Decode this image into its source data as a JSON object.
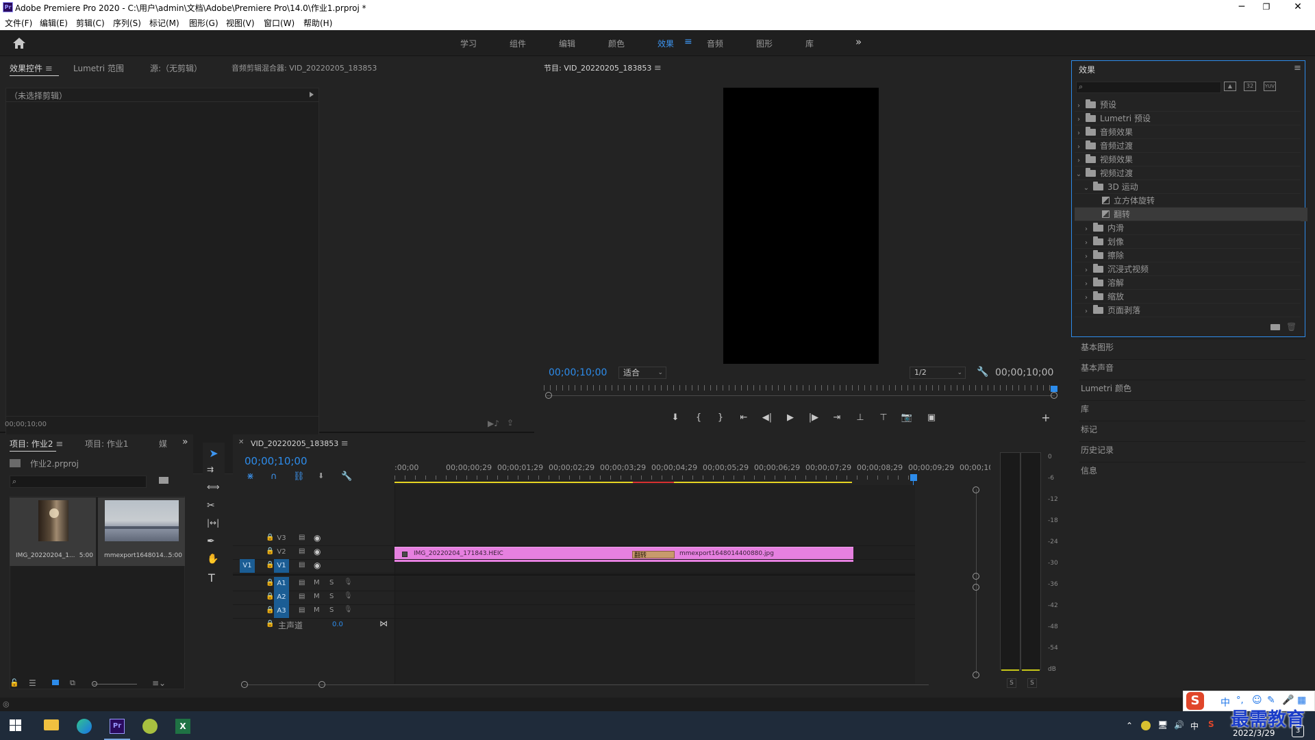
{
  "window": {
    "title": "Adobe Premiere Pro 2020 - C:\\用户\\admin\\文档\\Adobe\\Premiere Pro\\14.0\\作业1.prproj *",
    "menus": [
      "文件(F)",
      "编辑(E)",
      "剪辑(C)",
      "序列(S)",
      "标记(M)",
      "图形(G)",
      "视图(V)",
      "窗口(W)",
      "帮助(H)"
    ]
  },
  "workspaces": [
    "学习",
    "组件",
    "编辑",
    "颜色",
    "效果",
    "音频",
    "图形",
    "库"
  ],
  "effect_controls": {
    "tabs": [
      "效果控件",
      "Lumetri 范围",
      "源:（无剪辑）",
      "音频剪辑混合器: VID_20220205_183853"
    ],
    "no_clip": "（未选择剪辑）",
    "timecode": "00;00;10;00"
  },
  "program_monitor": {
    "title": "节目: VID_20220205_183853",
    "timecode_left": "00;00;10;00",
    "fit": "适合",
    "resolution": "1/2",
    "timecode_right": "00;00;10;00"
  },
  "effects_panel": {
    "title": "效果",
    "search_placeholder": "",
    "tree": [
      {
        "label": "预设",
        "level": 0,
        "expanded": false,
        "kind": "preset"
      },
      {
        "label": "Lumetri 预设",
        "level": 0,
        "expanded": false,
        "kind": "preset"
      },
      {
        "label": "音频效果",
        "level": 0,
        "expanded": false,
        "kind": "folder"
      },
      {
        "label": "音频过渡",
        "level": 0,
        "expanded": false,
        "kind": "folder"
      },
      {
        "label": "视频效果",
        "level": 0,
        "expanded": false,
        "kind": "folder"
      },
      {
        "label": "视频过渡",
        "level": 0,
        "expanded": true,
        "kind": "folder"
      },
      {
        "label": "3D 运动",
        "level": 1,
        "expanded": true,
        "kind": "folder"
      },
      {
        "label": "立方体旋转",
        "level": 2,
        "expanded": false,
        "kind": "effect"
      },
      {
        "label": "翻转",
        "level": 2,
        "expanded": false,
        "kind": "effect",
        "selected": true
      },
      {
        "label": "内滑",
        "level": 1,
        "expanded": false,
        "kind": "folder"
      },
      {
        "label": "划像",
        "level": 1,
        "expanded": false,
        "kind": "folder"
      },
      {
        "label": "擦除",
        "level": 1,
        "expanded": false,
        "kind": "folder"
      },
      {
        "label": "沉浸式视频",
        "level": 1,
        "expanded": false,
        "kind": "folder"
      },
      {
        "label": "溶解",
        "level": 1,
        "expanded": false,
        "kind": "folder"
      },
      {
        "label": "缩放",
        "level": 1,
        "expanded": false,
        "kind": "folder"
      },
      {
        "label": "页面剥落",
        "level": 1,
        "expanded": false,
        "kind": "folder"
      }
    ]
  },
  "right_panels": [
    "基本图形",
    "基本声音",
    "Lumetri 颜色",
    "库",
    "标记",
    "历史记录",
    "信息"
  ],
  "project_panel": {
    "tabs": [
      "项目: 作业2",
      "项目: 作业1",
      "媒"
    ],
    "file": "作业2.prproj",
    "items": [
      {
        "name": "IMG_20220204_1...",
        "duration": "5:00"
      },
      {
        "name": "mmexport1648014...",
        "duration": "5:00"
      }
    ]
  },
  "timeline": {
    "tab": "VID_20220205_183853",
    "timecode": "00;00;10;00",
    "ruler": [
      ":00;00",
      "00;00;00;29",
      "00;00;01;29",
      "00;00;02;29",
      "00;00;03;29",
      "00;00;04;29",
      "00;00;05;29",
      "00;00;06;29",
      "00;00;07;29",
      "00;00;08;29",
      "00;00;09;29",
      "00;00;10;"
    ],
    "video_tracks": [
      "V3",
      "V2",
      "V1"
    ],
    "audio_tracks": [
      "A1",
      "A2",
      "A3"
    ],
    "source_patch": "V1",
    "master_label": "主声道",
    "master_value": "0.0",
    "clip1": "IMG_20220204_171843.HEIC",
    "clip2": "mmexport1648014400880.jpg",
    "transition": "翻转",
    "ms": [
      "M",
      "S"
    ]
  },
  "meter": {
    "scale": [
      "0",
      "-6",
      "-12",
      "-18",
      "-24",
      "-30",
      "-36",
      "-42",
      "-48",
      "-54",
      "dB"
    ],
    "solo": [
      "S",
      "S"
    ]
  },
  "taskbar": {
    "ime": [
      "中",
      "°,"
    ],
    "watermark": "最需教育",
    "date": "2022/3/29",
    "badge": "3"
  },
  "colors": {
    "accent": "#2d8ceb",
    "clip": "#e680e0",
    "track_active": "#1b5d94"
  }
}
